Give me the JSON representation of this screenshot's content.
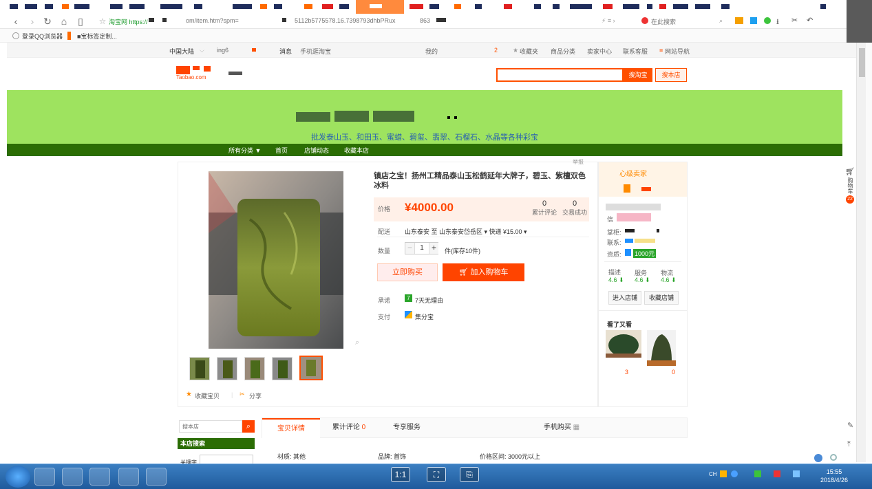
{
  "browser": {
    "url_prefix": "淘宝网 https://",
    "url_mid": "om/item.htm?spm=",
    "url_id": "5112b5775578.16.7398793dhbPRux",
    "url_end": "863",
    "search_engine_label": "在此搜索",
    "bookmarks": [
      "登录QQ浏览器",
      "■宝标签定制..."
    ]
  },
  "site_nav": {
    "region": "中国大陆",
    "user": "ing6",
    "messages": "消息",
    "mobile": "手机逛淘宝",
    "my": "我的",
    "cart_count": "2",
    "favorites": "收藏夹",
    "categories": "商品分类",
    "seller_center": "卖家中心",
    "service": "联系客服",
    "site_nav": "网站导航"
  },
  "header": {
    "logo_text": "Taobao.com",
    "search_placeholder": "",
    "search_taobao": "搜淘宝",
    "search_shop": "搜本店"
  },
  "banner": {
    "subtitle": "批发泰山玉、和田玉、蜜蜡、碧玺、翡翠、石榴石、水晶等各种彩宝",
    "nav": [
      "所有分类 ▼",
      "首页",
      "店铺动态",
      "收藏本店"
    ],
    "colors": {
      "banner_bg": "#9ee35f",
      "nav_bg": "#2b6d04"
    }
  },
  "product": {
    "report": "举报",
    "title": "镇店之宝！扬州工精品泰山玉松鹤延年大牌子，碧玉、紫檀双色冰料",
    "price_label": "价格",
    "price": "¥4000.00",
    "reviews_count": "0",
    "reviews_label": "累计评论",
    "sales_count": "0",
    "sales_label": "交易成功",
    "delivery_label": "配送",
    "delivery_text": "山东泰安 至 山东泰安岱岳区 ▾  快递 ¥15.00 ▾",
    "qty_label": "数量",
    "qty_value": "1",
    "qty_stock": "件(库存10件)",
    "buy_now": "立即购买",
    "add_cart": "加入购物车",
    "promise_label": "承诺",
    "promise_badge": "7",
    "promise_text": "7天无理由",
    "pay_label": "支付",
    "pay_text": "集分宝",
    "favorite": "收藏宝贝",
    "share": "分享",
    "accent": "#ff4400"
  },
  "seller": {
    "level": "心级卖家",
    "credit": "信",
    "ww_label": "掌柜:",
    "contact_label": "联系:",
    "qual_label": "资质:",
    "qual_value": "1000元",
    "scores": [
      {
        "name": "描述",
        "value": "4.6 ⬇"
      },
      {
        "name": "服务",
        "value": "4.6 ⬇"
      },
      {
        "name": "物流",
        "value": "4.6 ⬇"
      }
    ],
    "enter_shop": "进入店铺",
    "fav_shop": "收藏店铺",
    "also_viewed": "看了又看",
    "also_prices": [
      "3",
      "0"
    ]
  },
  "right_sidebar": {
    "cart": "购物车",
    "cart_badge": "22"
  },
  "shop_search": {
    "placeholder": "搜本店",
    "section": "本店搜索",
    "keyword_label": "关键字"
  },
  "detail_tabs": {
    "tabs": [
      "宝贝详情",
      "累计评论",
      "专享服务"
    ],
    "reviews_count": "0",
    "mobile_buy": "手机购买",
    "attrs": [
      "材质: 其他",
      "品牌: 首饰",
      "价格区间: 3000元以上"
    ]
  },
  "taskbar": {
    "view_1to1": "1:1",
    "time": "15:55",
    "date": "2018/4/26",
    "ime": "CH"
  }
}
